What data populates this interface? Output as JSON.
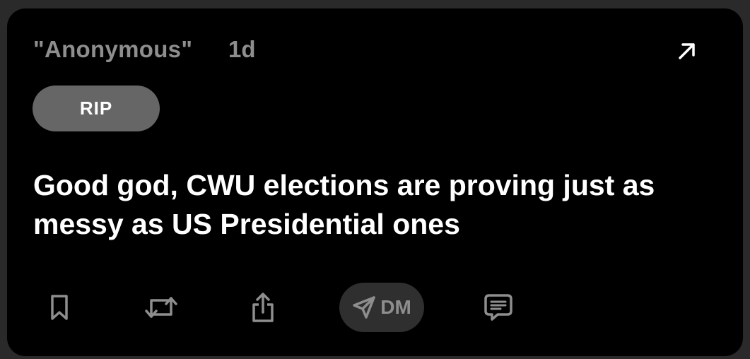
{
  "post": {
    "author": "\"Anonymous\"",
    "time": "1d",
    "tag": "RIP",
    "text": "Good god, CWU elections are proving just as messy as US Presidential ones"
  },
  "actions": {
    "dm_label": "DM",
    "icons": [
      "bookmark-icon",
      "repost-icon",
      "share-icon",
      "send-icon",
      "comment-icon"
    ]
  },
  "colors": {
    "card_background": "#000000",
    "page_background": "#2a2a2a",
    "muted_text": "#8e8e8e",
    "tag_background": "#666666",
    "dm_background": "#2f2f2f"
  }
}
